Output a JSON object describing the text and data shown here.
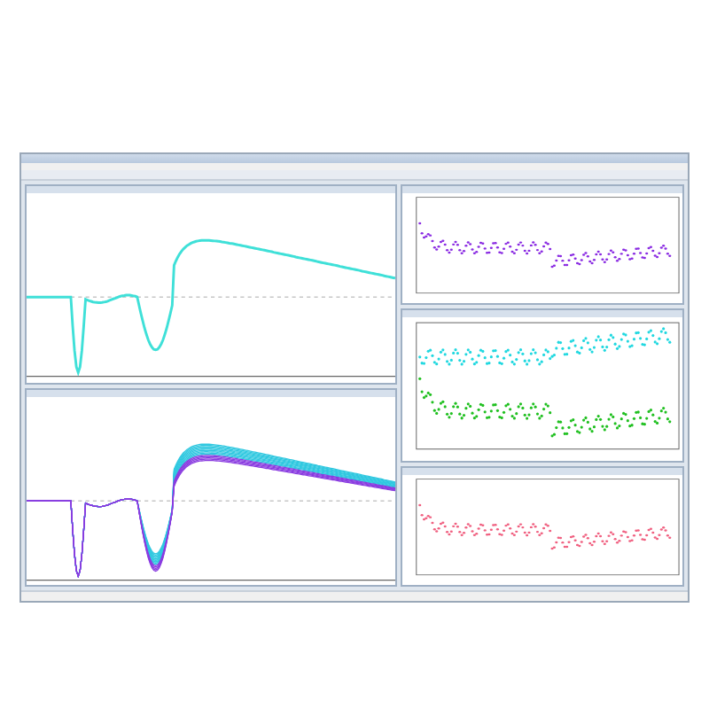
{
  "left_panels": [
    {
      "kind": "trace",
      "color": "#3fe0d8"
    },
    {
      "kind": "overlay",
      "color": "#30c8e0"
    }
  ],
  "right_panels": [
    {
      "kind": "scatter",
      "series": [
        {
          "color": "#8a2be2"
        }
      ]
    },
    {
      "kind": "scatter",
      "series": [
        {
          "color": "#20d8e0"
        },
        {
          "color": "#20c020"
        }
      ]
    },
    {
      "kind": "scatter",
      "series": [
        {
          "color": "#f06080"
        }
      ]
    }
  ]
}
